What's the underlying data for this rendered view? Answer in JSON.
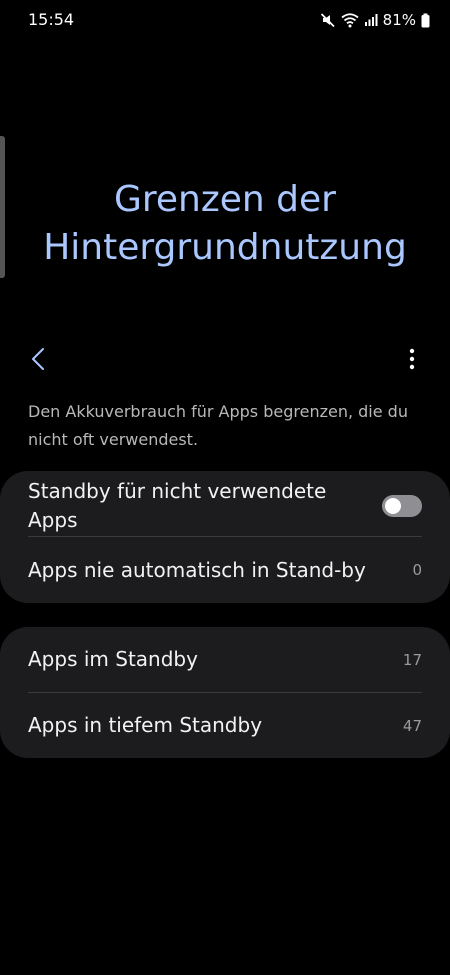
{
  "status_bar": {
    "time": "15:54",
    "battery_percent": "81%",
    "icons": [
      "mute-icon",
      "wifi-icon",
      "signal-icon",
      "battery-icon"
    ]
  },
  "page": {
    "title_line1": "Grenzen der",
    "title_line2": "Hintergrundnutzung",
    "description": "Den Akkuverbrauch für Apps begrenzen, die du nicht oft verwendest.",
    "accent_color": "#aac7ff"
  },
  "toolbar": {
    "back_icon": "chevron-left-icon",
    "more_icon": "more-vertical-icon"
  },
  "settings": {
    "standby_unused": {
      "label": "Standby für nicht verwendete Apps",
      "enabled": false
    },
    "never_standby": {
      "label": "Apps nie automatisch in Stand-by",
      "count": "0"
    }
  },
  "lists": {
    "standby": {
      "label": "Apps im Standby",
      "count": "17"
    },
    "deep_standby": {
      "label": "Apps in tiefem Standby",
      "count": "47"
    }
  }
}
